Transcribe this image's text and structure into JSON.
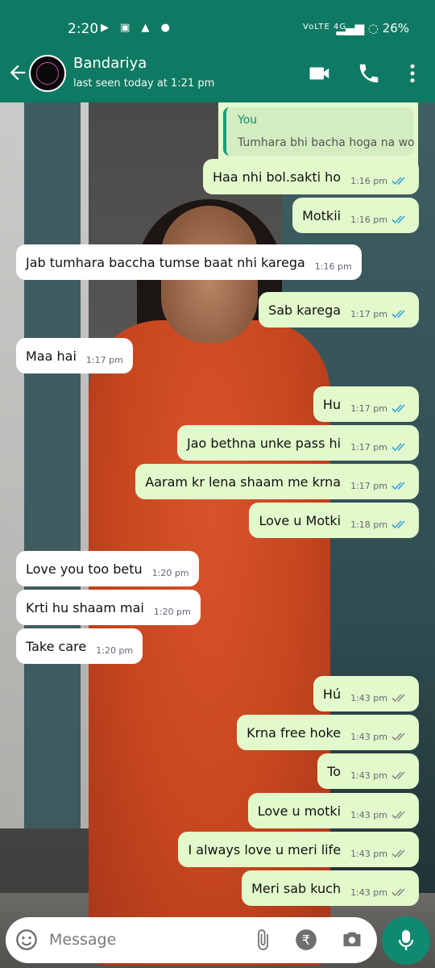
{
  "status_bar": {
    "time": "2:20",
    "network_label": "VoLTE 4G",
    "battery": "26%"
  },
  "header": {
    "contact_name": "Bandariya",
    "last_seen": "last seen today at 1:21 pm"
  },
  "reply": {
    "author": "You",
    "quoted_text": "Tumhara bhi bacha hoga na wo"
  },
  "messages": [
    {
      "dir": "out",
      "text": "Haa nhi bol.sakti ho",
      "time": "1:16 pm",
      "read": true
    },
    {
      "dir": "out",
      "text": "Motkii",
      "time": "1:16 pm",
      "read": true
    },
    {
      "dir": "in",
      "text": "Jab tumhara baccha tumse baat nhi karega",
      "time": "1:16 pm"
    },
    {
      "dir": "out",
      "text": "Sab karega",
      "time": "1:17 pm",
      "read": true
    },
    {
      "dir": "in",
      "text": "Maa hai",
      "time": "1:17 pm"
    },
    {
      "dir": "out",
      "text": "Hu",
      "time": "1:17 pm",
      "read": true
    },
    {
      "dir": "out",
      "text": "Jao bethna unke pass hi",
      "time": "1:17 pm",
      "read": true
    },
    {
      "dir": "out",
      "text": "Aaram kr lena shaam me krna",
      "time": "1:17 pm",
      "read": true
    },
    {
      "dir": "out",
      "text": "Love u Motki",
      "time": "1:18 pm",
      "read": true
    },
    {
      "dir": "in",
      "text": "Love you too betu",
      "time": "1:20 pm"
    },
    {
      "dir": "in",
      "text": "Krti hu shaam mai",
      "time": "1:20 pm"
    },
    {
      "dir": "in",
      "text": "Take care",
      "time": "1:20 pm"
    },
    {
      "dir": "out",
      "text": "Hú",
      "time": "1:43 pm",
      "read": false
    },
    {
      "dir": "out",
      "text": "Krna free hoke",
      "time": "1:43 pm",
      "read": false
    },
    {
      "dir": "out",
      "text": "To",
      "time": "1:43 pm",
      "read": false
    },
    {
      "dir": "out",
      "text": "Love u motki",
      "time": "1:43 pm",
      "read": false
    },
    {
      "dir": "out",
      "text": "I always love u meri life",
      "time": "1:43 pm",
      "read": false
    },
    {
      "dir": "out",
      "text": "Meri sab kuch",
      "time": "1:43 pm",
      "read": false
    }
  ],
  "composer": {
    "placeholder": "Message"
  },
  "colors": {
    "header": "#0f7a63",
    "outgoing_bubble": "#e2f9cb",
    "incoming_bubble": "#ffffff",
    "read_ticks": "#3b9fe0",
    "unread_ticks": "#8a8a8a",
    "mic_button": "#0f8a70"
  }
}
